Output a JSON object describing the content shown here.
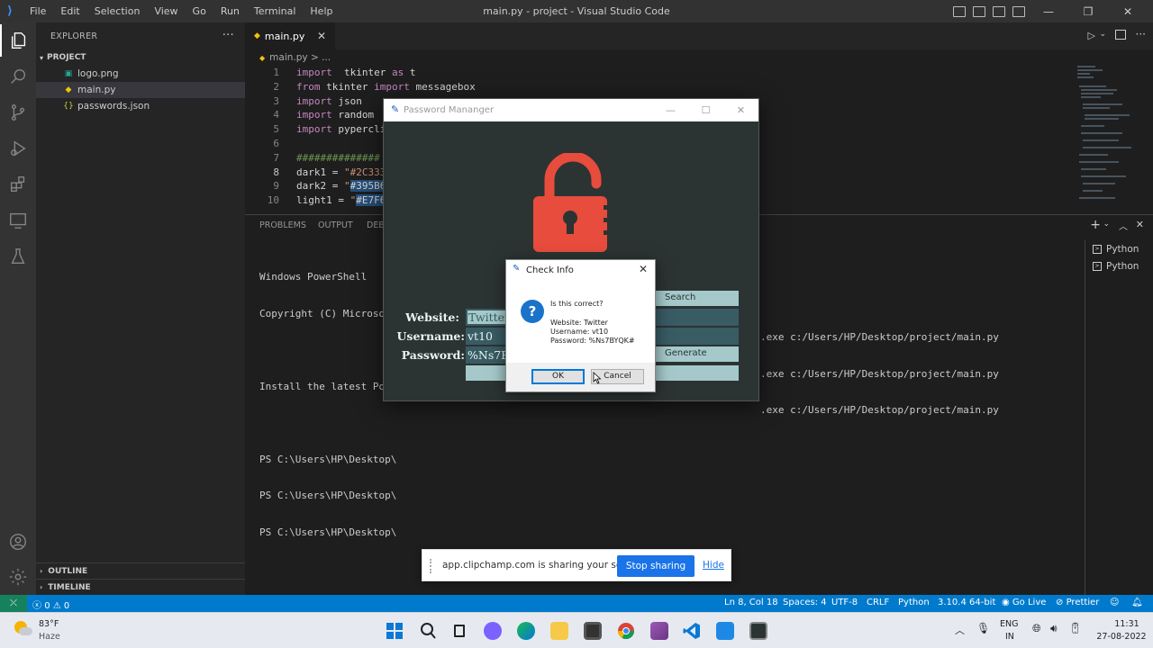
{
  "window": {
    "title": "main.py - project - Visual Studio Code",
    "menu": [
      "File",
      "Edit",
      "Selection",
      "View",
      "Go",
      "Run",
      "Terminal",
      "Help"
    ]
  },
  "sidebar": {
    "header": "EXPLORER",
    "project": "PROJECT",
    "files": [
      {
        "name": "logo.png",
        "icon": "image-file-icon",
        "color": "#26a69a"
      },
      {
        "name": "main.py",
        "icon": "python-file-icon",
        "color": "#f1c40f"
      },
      {
        "name": "passwords.json",
        "icon": "json-file-icon",
        "color": "#cbcb41"
      }
    ],
    "outline": "OUTLINE",
    "timeline": "TIMELINE"
  },
  "editor": {
    "tab": "main.py",
    "breadcrumb": "main.py > ...",
    "lines": [
      {
        "n": "1",
        "parts": [
          [
            "kw",
            "import"
          ],
          [
            "",
            "  tkinter "
          ],
          [
            "kw",
            "as"
          ],
          [
            "",
            " t"
          ]
        ]
      },
      {
        "n": "2",
        "parts": [
          [
            "kw",
            "from"
          ],
          [
            "",
            " tkinter "
          ],
          [
            "kw",
            "import"
          ],
          [
            "",
            " messagebox"
          ]
        ]
      },
      {
        "n": "3",
        "parts": [
          [
            "kw",
            "import"
          ],
          [
            "",
            " json"
          ]
        ]
      },
      {
        "n": "4",
        "parts": [
          [
            "kw",
            "import"
          ],
          [
            "",
            " random"
          ]
        ]
      },
      {
        "n": "5",
        "parts": [
          [
            "kw",
            "import"
          ],
          [
            "",
            " pypercli"
          ]
        ]
      },
      {
        "n": "6",
        "parts": []
      },
      {
        "n": "7",
        "parts": [
          [
            "cmt",
            "##############"
          ]
        ]
      },
      {
        "n": "8",
        "parts": [
          [
            "",
            "dark1 = "
          ],
          [
            "str",
            "\"#2C333"
          ]
        ]
      },
      {
        "n": "9",
        "parts": [
          [
            "",
            "dark2 = "
          ],
          [
            "str",
            "\""
          ],
          [
            "hl",
            "#395B6"
          ]
        ]
      },
      {
        "n": "10",
        "parts": [
          [
            "",
            "light1 = "
          ],
          [
            "str",
            "\""
          ],
          [
            "hl",
            "#E7F6"
          ]
        ]
      }
    ]
  },
  "panel": {
    "tabs": [
      "PROBLEMS",
      "OUTPUT",
      "DEBU"
    ],
    "terminal": [
      "Windows PowerShell",
      "Copyright (C) Microsoft",
      "",
      "Install the latest Powe",
      "",
      "PS C:\\Users\\HP\\Desktop\\",
      "PS C:\\Users\\HP\\Desktop\\",
      "PS C:\\Users\\HP\\Desktop\\"
    ],
    "terminal_right": [
      ".exe c:/Users/HP/Desktop/project/main.py",
      ".exe c:/Users/HP/Desktop/project/main.py",
      ".exe c:/Users/HP/Desktop/project/main.py"
    ],
    "terminals": [
      "Python",
      "Python"
    ]
  },
  "pm": {
    "title": "Password Mananger",
    "labels": {
      "website": "Website:",
      "username": "Username:",
      "password": "Password:"
    },
    "values": {
      "website": "Twitter",
      "username": "vt10",
      "password": "%Ns7E"
    },
    "buttons": {
      "search": "Search",
      "generate": "Generate"
    },
    "colors": {
      "dark1": "#2C3333",
      "dark2": "#395B64",
      "light1": "#E7F6F2",
      "accent": "#e74c3c"
    }
  },
  "dialog": {
    "title": "Check Info",
    "question": "Is this correct?",
    "website": "Website: Twitter",
    "username": "Username: vt10",
    "password": "Password: %Ns7BYQK#",
    "ok": "OK",
    "cancel": "Cancel"
  },
  "share": {
    "message": "app.clipchamp.com is sharing your screen.",
    "stop": "Stop sharing",
    "hide": "Hide"
  },
  "status": {
    "errors": "0",
    "warnings": "0",
    "position": "Ln 8, Col 18",
    "spaces": "Spaces: 4",
    "encoding": "UTF-8",
    "eol": "CRLF",
    "language": "Python",
    "interpreter": "3.10.4 64-bit",
    "golive": "Go Live",
    "prettier": "Prettier"
  },
  "taskbar": {
    "weather_temp": "83°F",
    "weather_desc": "Haze",
    "lang1": "ENG",
    "lang2": "IN",
    "time": "11:31",
    "date": "27-08-2022"
  }
}
